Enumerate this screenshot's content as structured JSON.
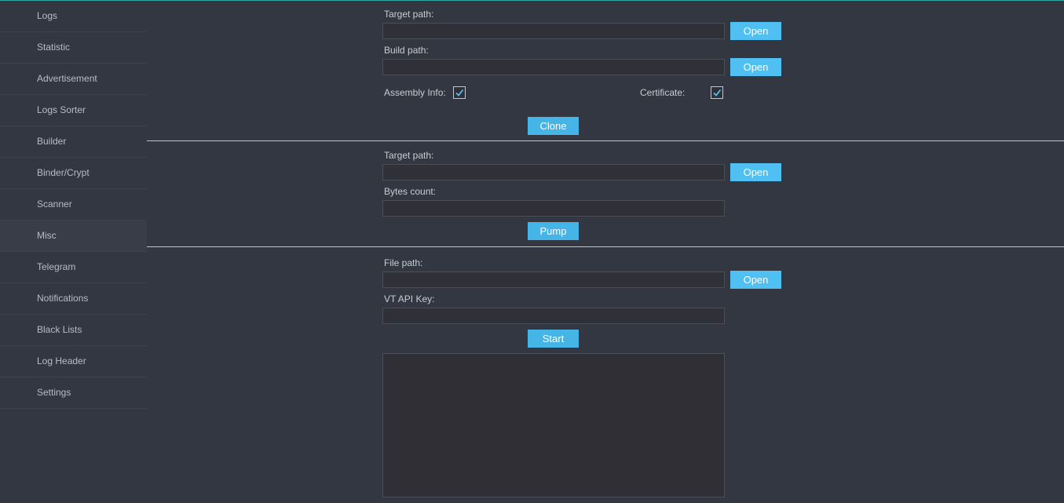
{
  "sidebar": {
    "items": [
      {
        "label": "Logs"
      },
      {
        "label": "Statistic"
      },
      {
        "label": "Advertisement"
      },
      {
        "label": "Logs Sorter"
      },
      {
        "label": "Builder"
      },
      {
        "label": "Binder/Crypt"
      },
      {
        "label": "Scanner"
      },
      {
        "label": "Misc",
        "active": true
      },
      {
        "label": "Telegram"
      },
      {
        "label": "Notifications"
      },
      {
        "label": "Black Lists"
      },
      {
        "label": "Log Header"
      },
      {
        "label": "Settings"
      }
    ]
  },
  "clone_section": {
    "target_path_label": "Target path:",
    "target_path_value": "",
    "build_path_label": "Build path:",
    "build_path_value": "",
    "open_label": "Open",
    "assembly_info_label": "Assembly Info:",
    "assembly_info_checked": true,
    "certificate_label": "Certificate:",
    "certificate_checked": true,
    "clone_label": "Clone"
  },
  "pump_section": {
    "target_path_label": "Target path:",
    "target_path_value": "",
    "open_label": "Open",
    "bytes_count_label": "Bytes count:",
    "bytes_count_value": "",
    "pump_label": "Pump"
  },
  "scan_section": {
    "file_path_label": "File path:",
    "file_path_value": "",
    "open_label": "Open",
    "vt_api_key_label": "VT API Key:",
    "vt_api_key_value": "",
    "start_label": "Start",
    "output_text": ""
  },
  "colors": {
    "background": "#333742",
    "accent_button": "#45b4e6",
    "top_accent": "#2ea9a0"
  }
}
